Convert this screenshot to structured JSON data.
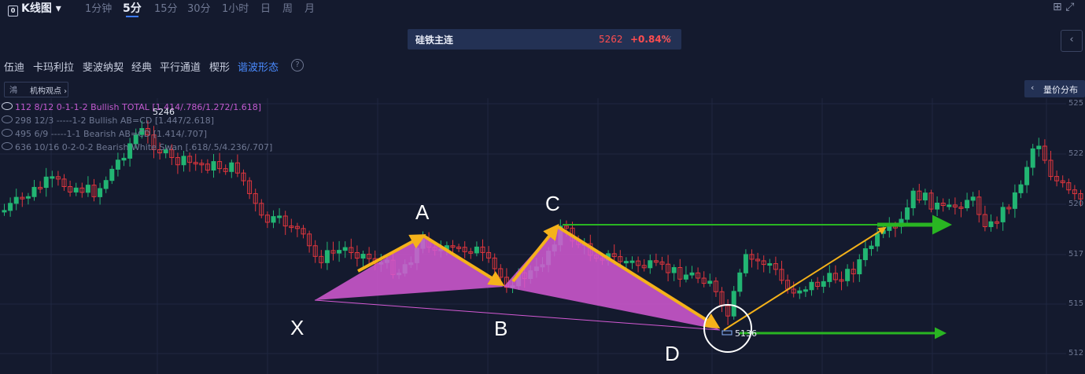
{
  "header": {
    "chart_type": "K线图",
    "timeframes": [
      "1分钟",
      "5分",
      "15分",
      "30分",
      "1小时",
      "日",
      "周",
      "月"
    ],
    "active_timeframe": "5分"
  },
  "contract": {
    "name": "硅铁主连",
    "price": "5262",
    "change": "+0.84%"
  },
  "tools": [
    "伍迪",
    "卡玛利拉",
    "斐波纳契",
    "经典",
    "平行通道",
    "楔形",
    "谐波形态"
  ],
  "active_tool": "谐波形态",
  "chips": {
    "institution": "机构观点",
    "volume_profile": "量价分布"
  },
  "patterns": [
    "112 8/12 0-1-1-2 Bullish TOTAL [1.414/.786/1.272/1.618]",
    "298 12/3 -----1-2 Bullish AB=CD [1.447/2.618]",
    "495 6/9 -----1-1 Bearish AB=CD [1.414/.707]",
    "636 10/16 0-2-0-2 Bearish White Swan [.618/.5/4.236/.707]"
  ],
  "price_axis": [
    "525",
    "522",
    "520",
    "517",
    "515",
    "512"
  ],
  "high_label": "5246",
  "low_label": "5136",
  "points": {
    "X": "X",
    "A": "A",
    "B": "B",
    "C": "C",
    "D": "D"
  },
  "colors": {
    "up": "#22b573",
    "down": "#e0363d",
    "pattern": "#d45ad4",
    "arrow": "#f5b21a",
    "target": "#29b522",
    "accent": "#3d7bff"
  },
  "icons": [
    "grid-icon",
    "expand-icon",
    "help-icon",
    "eye-icon",
    "chevron-down-icon"
  ]
}
